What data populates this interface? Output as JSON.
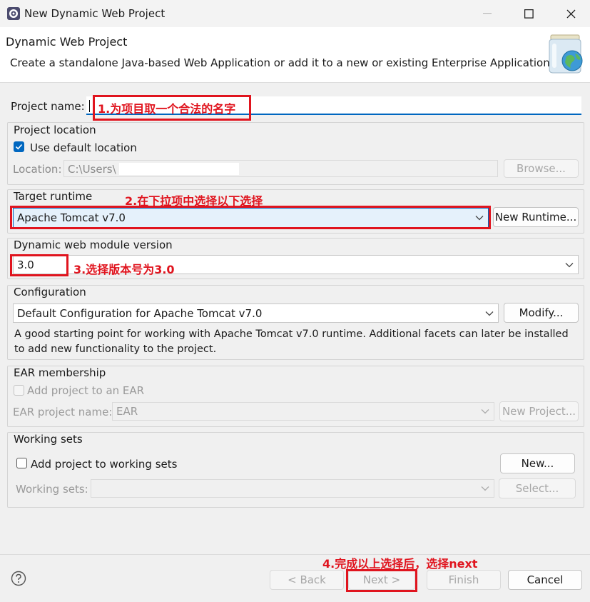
{
  "window": {
    "title": "New Dynamic Web Project",
    "minimize_icon": "minimize-icon",
    "maximize_icon": "maximize-icon",
    "close_icon": "close-icon"
  },
  "header": {
    "title": "Dynamic Web Project",
    "description": "Create a standalone Java-based Web Application or add it to a new or existing Enterprise Application.",
    "graphic_icon": "web-project-jar-globe-icon"
  },
  "project_name": {
    "label": "Project name:",
    "value": ""
  },
  "project_location": {
    "group_label": "Project location",
    "use_default_label": "Use default location",
    "use_default_checked": true,
    "location_label": "Location:",
    "location_value": "C:\\Users\\",
    "browse_label": "Browse..."
  },
  "target_runtime": {
    "group_label": "Target runtime",
    "selected": "Apache Tomcat v7.0",
    "new_runtime_label": "New Runtime..."
  },
  "module_version": {
    "group_label": "Dynamic web module version",
    "selected": "3.0"
  },
  "configuration": {
    "group_label": "Configuration",
    "selected": "Default Configuration for Apache Tomcat v7.0",
    "modify_label": "Modify...",
    "description_line1": "A good starting point for working with Apache Tomcat v7.0 runtime. Additional facets can later be installed",
    "description_line2": "to add new functionality to the project."
  },
  "ear": {
    "group_label": "EAR membership",
    "add_label": "Add project to an EAR",
    "name_label": "EAR project name:",
    "name_value": "EAR",
    "new_project_label": "New Project..."
  },
  "working_sets": {
    "group_label": "Working sets",
    "add_label": "Add project to working sets",
    "new_label": "New...",
    "sets_label": "Working sets:",
    "select_label": "Select..."
  },
  "footer": {
    "help_icon": "help-icon",
    "back_label": "< Back",
    "next_label": "Next >",
    "finish_label": "Finish",
    "cancel_label": "Cancel"
  },
  "annotations": {
    "a1": "1.为项目取一个合法的名字",
    "a2": "2.在下拉项中选择以下选择",
    "a3": "3.选择版本号为3.0",
    "a4": "4.完成以上选择后，选择next",
    "color": "#e0141e"
  },
  "colors": {
    "accent": "#0067c0",
    "header_bg": "#ffffff",
    "dialog_bg": "#f0f0f0"
  }
}
